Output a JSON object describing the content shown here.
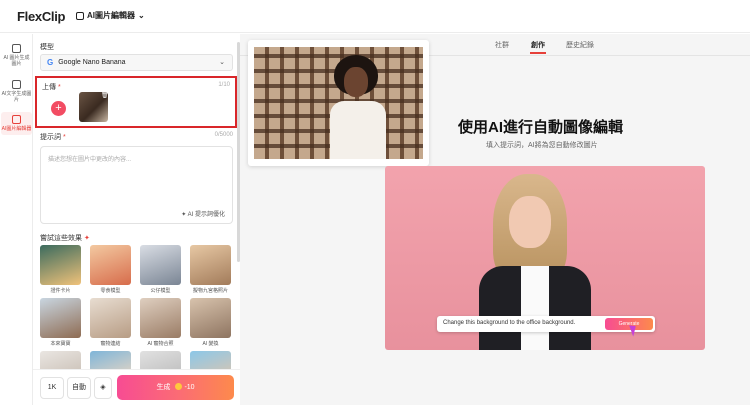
{
  "app": {
    "logo": "FlexClip",
    "tool_name": "AI圖片編輯器"
  },
  "rail": [
    {
      "label": "AI 圖片生成圖片",
      "icon": "image-stack-icon"
    },
    {
      "label": "AI文字生成圖片",
      "icon": "text-image-icon"
    },
    {
      "label": "AI圖片編輯器",
      "icon": "edit-image-icon",
      "active": true
    }
  ],
  "panel": {
    "model_label": "模型",
    "model_value": "Google Nano Banana",
    "upload_label": "上傳",
    "upload_count": "1/10",
    "prompt_label": "提示詞",
    "prompt_counter": "0/5000",
    "prompt_placeholder": "描述您想在圖片中更改的內容...",
    "prompt_optimize": "AI 提示詞優化",
    "effects_label": "嘗試這些效果",
    "effects": [
      {
        "caption": "證件卡片",
        "c1": "#3b6b5e",
        "c2": "#f0c27a"
      },
      {
        "caption": "零食模型",
        "c1": "#f3c9a1",
        "c2": "#d76c4b"
      },
      {
        "caption": "公仔模型",
        "c1": "#d9dde4",
        "c2": "#7a8594"
      },
      {
        "caption": "擬物九宮格照片",
        "c1": "#e7c8a4",
        "c2": "#a27b5a"
      },
      {
        "caption": "本來寶寶",
        "c1": "#c9d6e1",
        "c2": "#8e6b52"
      },
      {
        "caption": "寵物連結",
        "c1": "#e8ddd1",
        "c2": "#b79c84"
      },
      {
        "caption": "AI 寵物合照",
        "c1": "#dfcfc0",
        "c2": "#9a7c65"
      },
      {
        "caption": "AI 變換",
        "c1": "#d8c3ad",
        "c2": "#8e7460"
      },
      {
        "caption": "",
        "c1": "#eae6e2",
        "c2": "#c9bfb5"
      },
      {
        "caption": "",
        "c1": "#7fb5d9",
        "c2": "#e5d5c4"
      },
      {
        "caption": "",
        "c1": "#e1e1e1",
        "c2": "#bdbdbd"
      },
      {
        "caption": "",
        "c1": "#8cc7e8",
        "c2": "#d8c6b2"
      }
    ],
    "resolution": "1K",
    "auto": "自動",
    "generate_label": "生成",
    "generate_cost": "-10"
  },
  "main": {
    "tabs": [
      "社群",
      "創作",
      "歷史紀錄"
    ],
    "active_tab": 1,
    "headline": "使用AI進行自動圖像編輯",
    "subline": "填入提示詞，AI將為您自動修改圖片",
    "demo_prompt": "Change this background to the office background.",
    "demo_button": "Generate"
  }
}
